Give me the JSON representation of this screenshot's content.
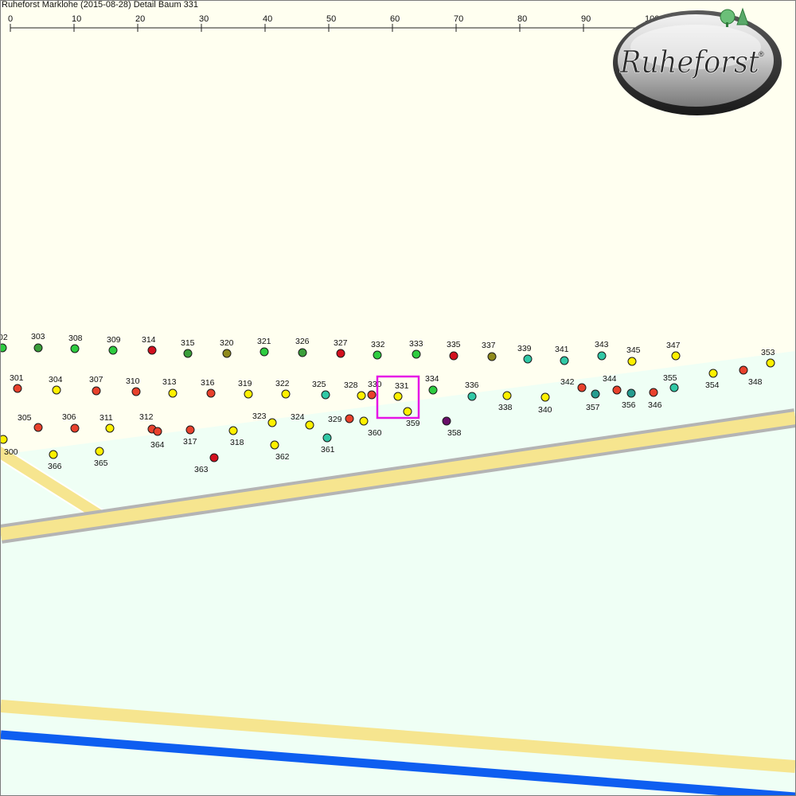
{
  "title": "Ruheforst Marklohe (2015-08-28) Detail  Baum 331",
  "scale": {
    "labels": [
      "0",
      "10",
      "20",
      "30",
      "40",
      "50",
      "60",
      "70",
      "80",
      "90",
      "100m"
    ]
  },
  "logo": {
    "text": "Ruheforst",
    "mark": "®"
  },
  "highlight": {
    "tree": "331",
    "color": "#e614e6"
  },
  "status_colors": {
    "green": "#2ecc40",
    "darkgreen": "#3a9e3a",
    "red": "#e8412c",
    "darkred": "#d2101e",
    "yellow": "#fff000",
    "olive": "#8f8a1c",
    "teal": "#31c8a6",
    "darkteal": "#259c90",
    "purple": "#6a0f6a"
  },
  "trees": [
    {
      "id": "02",
      "status": "green"
    },
    {
      "id": "303",
      "status": "darkgreen"
    },
    {
      "id": "308",
      "status": "green"
    },
    {
      "id": "309",
      "status": "green"
    },
    {
      "id": "314",
      "status": "darkred"
    },
    {
      "id": "315",
      "status": "darkgreen"
    },
    {
      "id": "320",
      "status": "olive"
    },
    {
      "id": "321",
      "status": "green"
    },
    {
      "id": "326",
      "status": "darkgreen"
    },
    {
      "id": "327",
      "status": "darkred"
    },
    {
      "id": "332",
      "status": "green"
    },
    {
      "id": "333",
      "status": "green"
    },
    {
      "id": "335",
      "status": "darkred"
    },
    {
      "id": "337",
      "status": "olive"
    },
    {
      "id": "339",
      "status": "teal"
    },
    {
      "id": "341",
      "status": "teal"
    },
    {
      "id": "343",
      "status": "teal"
    },
    {
      "id": "345",
      "status": "yellow"
    },
    {
      "id": "347",
      "status": "yellow"
    },
    {
      "id": "353",
      "status": "yellow"
    },
    {
      "id": "301",
      "status": "red"
    },
    {
      "id": "304",
      "status": "yellow"
    },
    {
      "id": "307",
      "status": "red"
    },
    {
      "id": "310",
      "status": "red"
    },
    {
      "id": "313",
      "status": "yellow"
    },
    {
      "id": "316",
      "status": "red"
    },
    {
      "id": "319",
      "status": "yellow"
    },
    {
      "id": "322",
      "status": "yellow"
    },
    {
      "id": "325",
      "status": "teal"
    },
    {
      "id": "328",
      "status": "yellow"
    },
    {
      "id": "330",
      "status": "red"
    },
    {
      "id": "331",
      "status": "yellow"
    },
    {
      "id": "334",
      "status": "green"
    },
    {
      "id": "336",
      "status": "teal"
    },
    {
      "id": "338",
      "status": "yellow"
    },
    {
      "id": "340",
      "status": "yellow"
    },
    {
      "id": "342",
      "status": "red"
    },
    {
      "id": "344",
      "status": "red"
    },
    {
      "id": "355",
      "status": "teal"
    },
    {
      "id": "354",
      "status": "yellow"
    },
    {
      "id": "348",
      "status": "red"
    },
    {
      "id": "357",
      "status": "darkteal"
    },
    {
      "id": "356",
      "status": "darkteal"
    },
    {
      "id": "346",
      "status": "red"
    },
    {
      "id": "305",
      "status": "red"
    },
    {
      "id": "306",
      "status": "red"
    },
    {
      "id": "311",
      "status": "yellow"
    },
    {
      "id": "312",
      "status": "red"
    },
    {
      "id": "364",
      "status": "red"
    },
    {
      "id": "317",
      "status": "red"
    },
    {
      "id": "318",
      "status": "yellow"
    },
    {
      "id": "323",
      "status": "yellow"
    },
    {
      "id": "324",
      "status": "yellow"
    },
    {
      "id": "329",
      "status": "red"
    },
    {
      "id": "360",
      "status": "yellow"
    },
    {
      "id": "359",
      "status": "yellow"
    },
    {
      "id": "358",
      "status": "purple"
    },
    {
      "id": "361",
      "status": "teal"
    },
    {
      "id": "362",
      "status": "yellow"
    },
    {
      "id": "363",
      "status": "darkred"
    },
    {
      "id": "300",
      "status": "yellow"
    },
    {
      "id": "366",
      "status": "yellow"
    },
    {
      "id": "365",
      "status": "yellow"
    }
  ]
}
